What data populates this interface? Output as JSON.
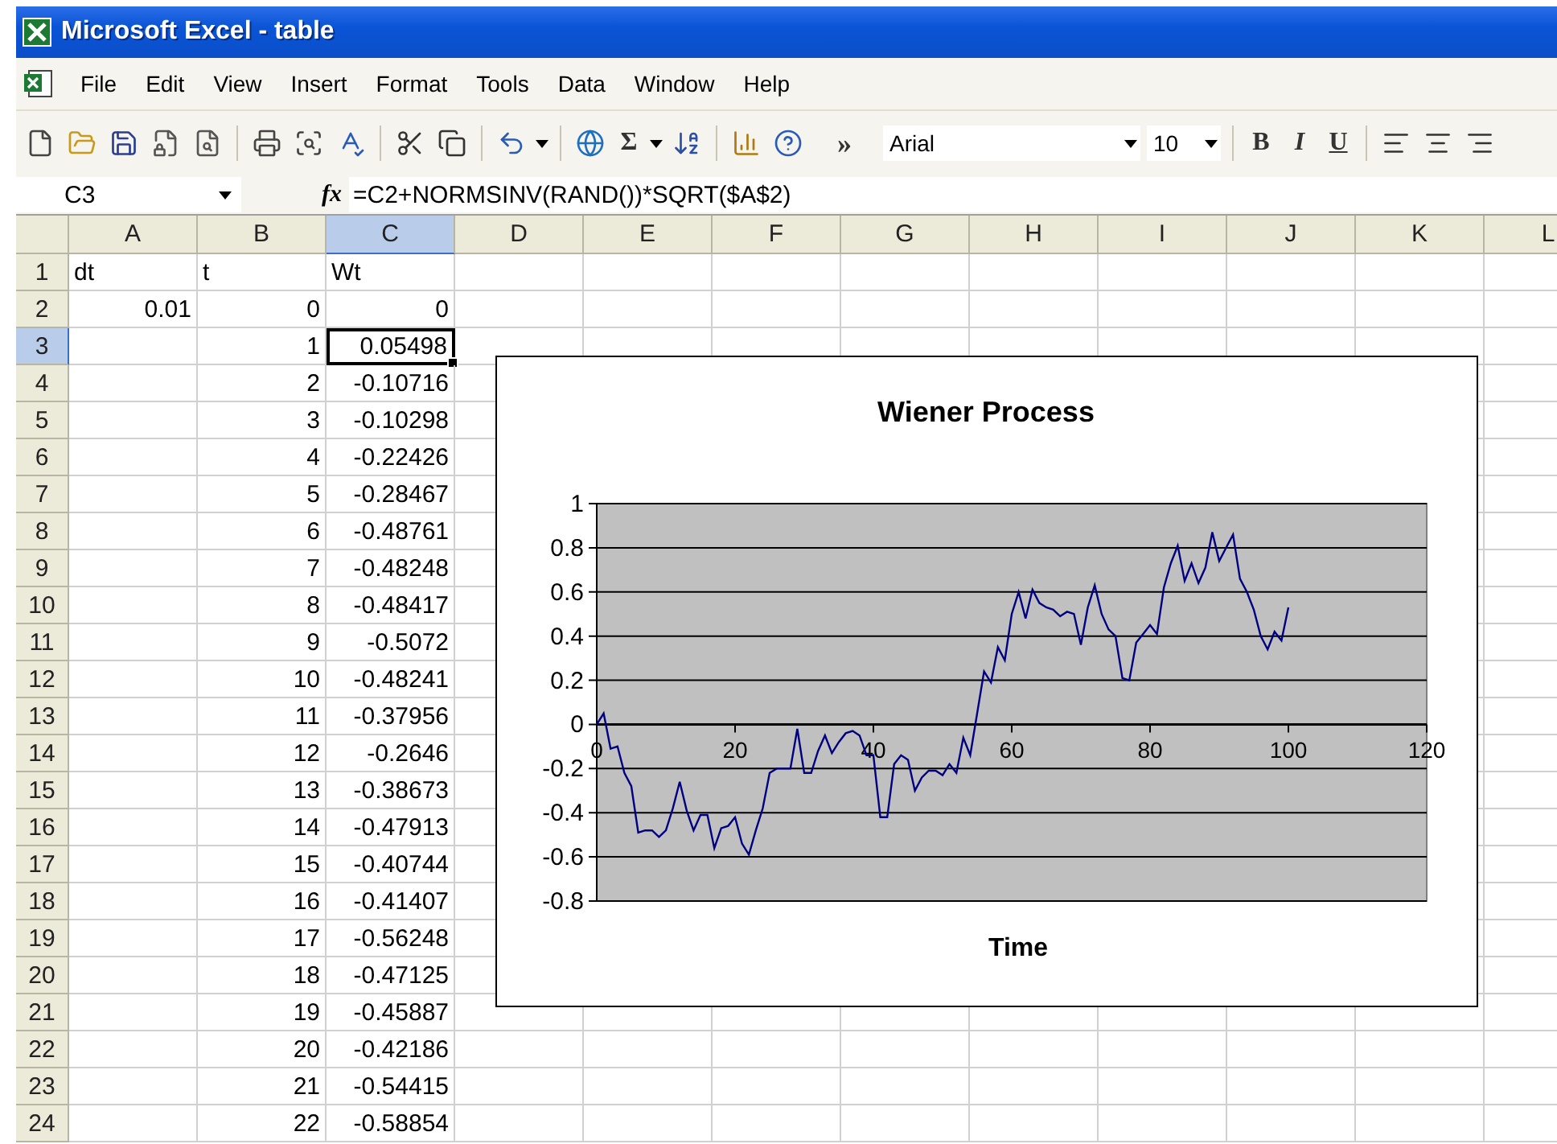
{
  "window": {
    "title": "Microsoft Excel - table"
  },
  "menu": [
    {
      "label": "File"
    },
    {
      "label": "Edit"
    },
    {
      "label": "View"
    },
    {
      "label": "Insert"
    },
    {
      "label": "Format"
    },
    {
      "label": "Tools"
    },
    {
      "label": "Data"
    },
    {
      "label": "Window"
    },
    {
      "label": "Help"
    }
  ],
  "toolbar": {
    "autosum": "Σ",
    "overflow": "»",
    "font": "Arial",
    "font_size": "10",
    "bold": "B",
    "italic": "I",
    "underline": "U"
  },
  "formula_bar": {
    "name_box": "C3",
    "function_button": "fx",
    "formula": "=C2+NORMSINV(RAND())*SQRT($A$2)"
  },
  "columns": [
    {
      "label": "A",
      "selected": false
    },
    {
      "label": "B",
      "selected": false
    },
    {
      "label": "C",
      "selected": true
    },
    {
      "label": "D",
      "selected": false
    },
    {
      "label": "E",
      "selected": false
    },
    {
      "label": "F",
      "selected": false
    },
    {
      "label": "G",
      "selected": false
    },
    {
      "label": "H",
      "selected": false
    },
    {
      "label": "I",
      "selected": false
    },
    {
      "label": "J",
      "selected": false
    },
    {
      "label": "K",
      "selected": false
    },
    {
      "label": "L",
      "selected": false
    }
  ],
  "rows": [
    {
      "header": "1",
      "selected": false,
      "cells": [
        {
          "text": "dt",
          "kind": "text",
          "active": false
        },
        {
          "text": "t",
          "kind": "text",
          "active": false
        },
        {
          "text": "Wt",
          "kind": "text",
          "active": false
        }
      ]
    },
    {
      "header": "2",
      "selected": false,
      "cells": [
        {
          "text": "0.01",
          "kind": "number",
          "active": false
        },
        {
          "text": "0",
          "kind": "number",
          "active": false
        },
        {
          "text": "0",
          "kind": "number",
          "active": false
        }
      ]
    },
    {
      "header": "3",
      "selected": true,
      "cells": [
        {
          "text": "1",
          "kind": "number",
          "active": false
        },
        {
          "text": "0.05498",
          "kind": "number",
          "active": true
        }
      ]
    },
    {
      "header": "4",
      "selected": false,
      "cells": [
        {
          "text": "2",
          "kind": "number",
          "active": false
        },
        {
          "text": "-0.10716",
          "kind": "number",
          "active": false
        }
      ]
    },
    {
      "header": "5",
      "selected": false,
      "cells": [
        {
          "text": "3",
          "kind": "number",
          "active": false
        },
        {
          "text": "-0.10298",
          "kind": "number",
          "active": false
        }
      ]
    },
    {
      "header": "6",
      "selected": false,
      "cells": [
        {
          "text": "4",
          "kind": "number",
          "active": false
        },
        {
          "text": "-0.22426",
          "kind": "number",
          "active": false
        }
      ]
    },
    {
      "header": "7",
      "selected": false,
      "cells": [
        {
          "text": "5",
          "kind": "number",
          "active": false
        },
        {
          "text": "-0.28467",
          "kind": "number",
          "active": false
        }
      ]
    },
    {
      "header": "8",
      "selected": false,
      "cells": [
        {
          "text": "6",
          "kind": "number",
          "active": false
        },
        {
          "text": "-0.48761",
          "kind": "number",
          "active": false
        }
      ]
    },
    {
      "header": "9",
      "selected": false,
      "cells": [
        {
          "text": "7",
          "kind": "number",
          "active": false
        },
        {
          "text": "-0.48248",
          "kind": "number",
          "active": false
        }
      ]
    },
    {
      "header": "10",
      "selected": false,
      "cells": [
        {
          "text": "8",
          "kind": "number",
          "active": false
        },
        {
          "text": "-0.48417",
          "kind": "number",
          "active": false
        }
      ]
    },
    {
      "header": "11",
      "selected": false,
      "cells": [
        {
          "text": "9",
          "kind": "number",
          "active": false
        },
        {
          "text": "-0.5072",
          "kind": "number",
          "active": false
        }
      ]
    },
    {
      "header": "12",
      "selected": false,
      "cells": [
        {
          "text": "10",
          "kind": "number",
          "active": false
        },
        {
          "text": "-0.48241",
          "kind": "number",
          "active": false
        }
      ]
    },
    {
      "header": "13",
      "selected": false,
      "cells": [
        {
          "text": "11",
          "kind": "number",
          "active": false
        },
        {
          "text": "-0.37956",
          "kind": "number",
          "active": false
        }
      ]
    },
    {
      "header": "14",
      "selected": false,
      "cells": [
        {
          "text": "12",
          "kind": "number",
          "active": false
        },
        {
          "text": "-0.2646",
          "kind": "number",
          "active": false
        }
      ]
    },
    {
      "header": "15",
      "selected": false,
      "cells": [
        {
          "text": "13",
          "kind": "number",
          "active": false
        },
        {
          "text": "-0.38673",
          "kind": "number",
          "active": false
        }
      ]
    },
    {
      "header": "16",
      "selected": false,
      "cells": [
        {
          "text": "14",
          "kind": "number",
          "active": false
        },
        {
          "text": "-0.47913",
          "kind": "number",
          "active": false
        }
      ]
    },
    {
      "header": "17",
      "selected": false,
      "cells": [
        {
          "text": "15",
          "kind": "number",
          "active": false
        },
        {
          "text": "-0.40744",
          "kind": "number",
          "active": false
        }
      ]
    },
    {
      "header": "18",
      "selected": false,
      "cells": [
        {
          "text": "16",
          "kind": "number",
          "active": false
        },
        {
          "text": "-0.41407",
          "kind": "number",
          "active": false
        }
      ]
    },
    {
      "header": "19",
      "selected": false,
      "cells": [
        {
          "text": "17",
          "kind": "number",
          "active": false
        },
        {
          "text": "-0.56248",
          "kind": "number",
          "active": false
        }
      ]
    },
    {
      "header": "20",
      "selected": false,
      "cells": [
        {
          "text": "18",
          "kind": "number",
          "active": false
        },
        {
          "text": "-0.47125",
          "kind": "number",
          "active": false
        }
      ]
    },
    {
      "header": "21",
      "selected": false,
      "cells": [
        {
          "text": "19",
          "kind": "number",
          "active": false
        },
        {
          "text": "-0.45887",
          "kind": "number",
          "active": false
        }
      ]
    },
    {
      "header": "22",
      "selected": false,
      "cells": [
        {
          "text": "20",
          "kind": "number",
          "active": false
        },
        {
          "text": "-0.42186",
          "kind": "number",
          "active": false
        }
      ]
    },
    {
      "header": "23",
      "selected": false,
      "cells": [
        {
          "text": "21",
          "kind": "number",
          "active": false
        },
        {
          "text": "-0.54415",
          "kind": "number",
          "active": false
        }
      ]
    },
    {
      "header": "24",
      "selected": false,
      "cells": [
        {
          "text": "22",
          "kind": "number",
          "active": false
        },
        {
          "text": "-0.58854",
          "kind": "number",
          "active": false
        }
      ]
    }
  ],
  "chart": {
    "chart_data": {
      "type": "line",
      "title": "Wiener Process",
      "xlabel": "Time",
      "xlim": [
        0,
        120
      ],
      "ylim": [
        -0.8,
        1
      ],
      "grid": true,
      "xticks": [
        {
          "value": 0,
          "label": "0"
        },
        {
          "value": 20,
          "label": "20"
        },
        {
          "value": 40,
          "label": "40"
        },
        {
          "value": 60,
          "label": "60"
        },
        {
          "value": 80,
          "label": "80"
        },
        {
          "value": 100,
          "label": "100"
        },
        {
          "value": 120,
          "label": "120"
        }
      ],
      "yticks": [
        {
          "value": -0.8,
          "label": "-0.8"
        },
        {
          "value": -0.6,
          "label": "-0.6"
        },
        {
          "value": -0.4,
          "label": "-0.4"
        },
        {
          "value": -0.2,
          "label": "-0.2"
        },
        {
          "value": 0,
          "label": "0"
        },
        {
          "value": 0.2,
          "label": "0.2"
        },
        {
          "value": 0.4,
          "label": "0.4"
        },
        {
          "value": 0.6,
          "label": "0.6"
        },
        {
          "value": 0.8,
          "label": "0.8"
        },
        {
          "value": 1,
          "label": "1"
        }
      ],
      "x": [
        0,
        1,
        2,
        3,
        4,
        5,
        6,
        7,
        8,
        9,
        10,
        11,
        12,
        13,
        14,
        15,
        16,
        17,
        18,
        19,
        20,
        21,
        22,
        23,
        24,
        25,
        26,
        27,
        28,
        29,
        30,
        31,
        32,
        33,
        34,
        35,
        36,
        37,
        38,
        39,
        40,
        41,
        42,
        43,
        44,
        45,
        46,
        47,
        48,
        49,
        50,
        51,
        52,
        53,
        54,
        55,
        56,
        57,
        58,
        59,
        60,
        61,
        62,
        63,
        64,
        65,
        66,
        67,
        68,
        69,
        70,
        71,
        72,
        73,
        74,
        75,
        76,
        77,
        78,
        79,
        80,
        81,
        82,
        83,
        84,
        85,
        86,
        87,
        88,
        89,
        90,
        91,
        92,
        93,
        94,
        95,
        96,
        97,
        98,
        99,
        100
      ],
      "series": [
        {
          "color": "#000080",
          "values": [
            0,
            0.05,
            -0.11,
            -0.1,
            -0.22,
            -0.28,
            -0.49,
            -0.48,
            -0.48,
            -0.51,
            -0.48,
            -0.38,
            -0.26,
            -0.39,
            -0.48,
            -0.41,
            -0.41,
            -0.56,
            -0.47,
            -0.46,
            -0.42,
            -0.54,
            -0.59,
            -0.48,
            -0.38,
            -0.22,
            -0.2,
            -0.2,
            -0.2,
            -0.02,
            -0.22,
            -0.22,
            -0.12,
            -0.05,
            -0.13,
            -0.08,
            -0.04,
            -0.03,
            -0.05,
            -0.14,
            -0.14,
            -0.42,
            -0.42,
            -0.18,
            -0.14,
            -0.16,
            -0.3,
            -0.24,
            -0.21,
            -0.21,
            -0.23,
            -0.18,
            -0.22,
            -0.06,
            -0.14,
            0.05,
            0.24,
            0.19,
            0.35,
            0.29,
            0.5,
            0.6,
            0.48,
            0.61,
            0.55,
            0.53,
            0.52,
            0.49,
            0.51,
            0.5,
            0.36,
            0.53,
            0.63,
            0.5,
            0.43,
            0.4,
            0.21,
            0.2,
            0.37,
            0.41,
            0.45,
            0.41,
            0.62,
            0.73,
            0.81,
            0.65,
            0.73,
            0.64,
            0.71,
            0.87,
            0.74,
            0.8,
            0.86,
            0.66,
            0.6,
            0.52,
            0.4,
            0.34,
            0.42,
            0.38,
            0.53
          ]
        }
      ]
    }
  }
}
